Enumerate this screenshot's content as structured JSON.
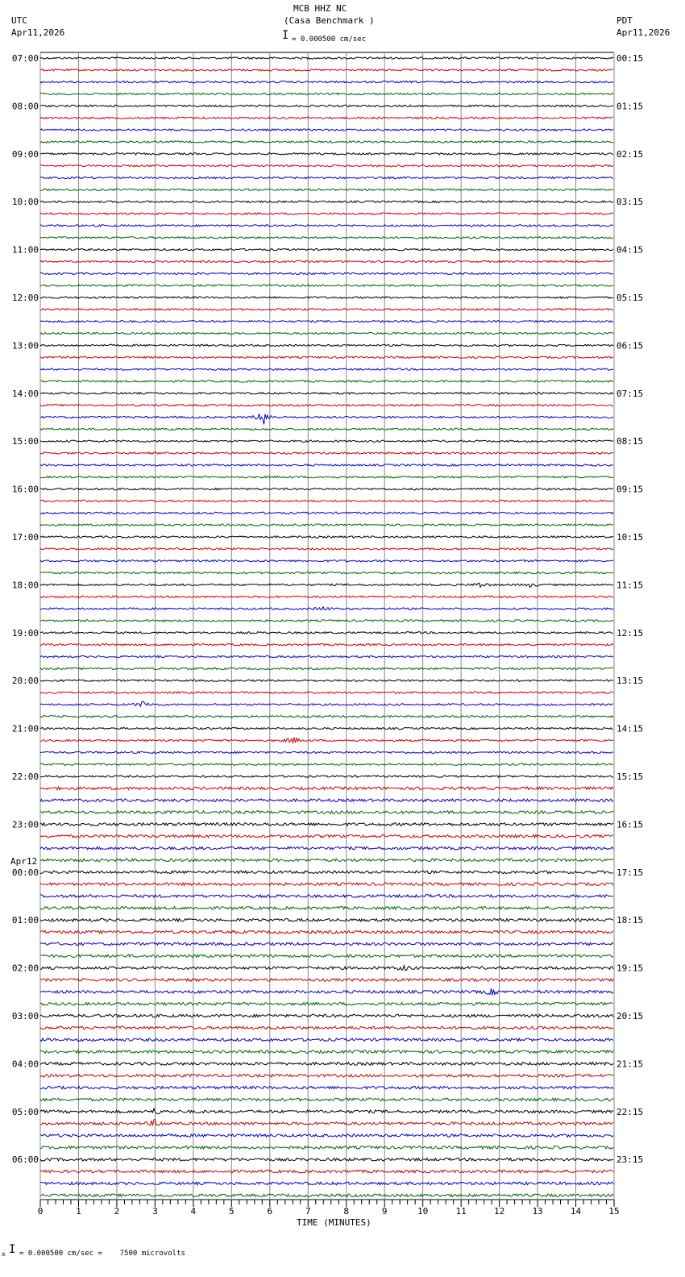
{
  "header": {
    "station": "MCB HHZ NC",
    "location": "(Casa Benchmark )",
    "left_tz": "UTC",
    "left_date": "Apr11,2026",
    "right_tz": "PDT",
    "right_date": "Apr11,2026",
    "scale": "= 0.000500 cm/sec"
  },
  "footer": {
    "scale": "= 0.000500 cm/sec =    7500 microvolts",
    "marker": "x"
  },
  "chart_data": {
    "type": "line",
    "title": "MCB HHZ NC (Casa Benchmark )",
    "xlabel": "TIME (MINUTES)",
    "xlim": [
      0,
      15
    ],
    "x_ticks": [
      "0",
      "1",
      "2",
      "3",
      "4",
      "5",
      "6",
      "7",
      "8",
      "9",
      "10",
      "11",
      "12",
      "13",
      "14",
      "15"
    ],
    "traces_per_hour": 4,
    "trace_count": 96,
    "trace_colors": [
      "#000000",
      "#cc0000",
      "#0000cc",
      "#006600"
    ],
    "left_labels": [
      "07:00",
      "08:00",
      "09:00",
      "10:00",
      "11:00",
      "12:00",
      "13:00",
      "14:00",
      "15:00",
      "16:00",
      "17:00",
      "18:00",
      "19:00",
      "20:00",
      "21:00",
      "22:00",
      "23:00",
      "00:00",
      "01:00",
      "02:00",
      "03:00",
      "04:00",
      "05:00",
      "06:00"
    ],
    "date_change_label": "Apr12",
    "right_labels": [
      "00:15",
      "01:15",
      "02:15",
      "03:15",
      "04:15",
      "05:15",
      "06:15",
      "07:15",
      "08:15",
      "09:15",
      "10:15",
      "11:15",
      "12:15",
      "13:15",
      "14:15",
      "15:15",
      "16:15",
      "17:15",
      "18:15",
      "19:15",
      "20:15",
      "21:15",
      "22:15",
      "23:15"
    ],
    "events": [
      {
        "trace": 30,
        "minute": 5.85,
        "amplitude": 10
      },
      {
        "trace": 44,
        "minute": 11.5,
        "amplitude": 3
      },
      {
        "trace": 44,
        "minute": 12.8,
        "amplitude": 2
      },
      {
        "trace": 46,
        "minute": 7.4,
        "amplitude": 2
      },
      {
        "trace": 54,
        "minute": 2.7,
        "amplitude": 4
      },
      {
        "trace": 57,
        "minute": 6.6,
        "amplitude": 4
      },
      {
        "trace": 76,
        "minute": 9.5,
        "amplitude": 2.5
      },
      {
        "trace": 78,
        "minute": 11.8,
        "amplitude": 3
      },
      {
        "trace": 88,
        "minute": 3,
        "amplitude": 3
      },
      {
        "trace": 89,
        "minute": 3,
        "amplitude": 4
      }
    ]
  }
}
